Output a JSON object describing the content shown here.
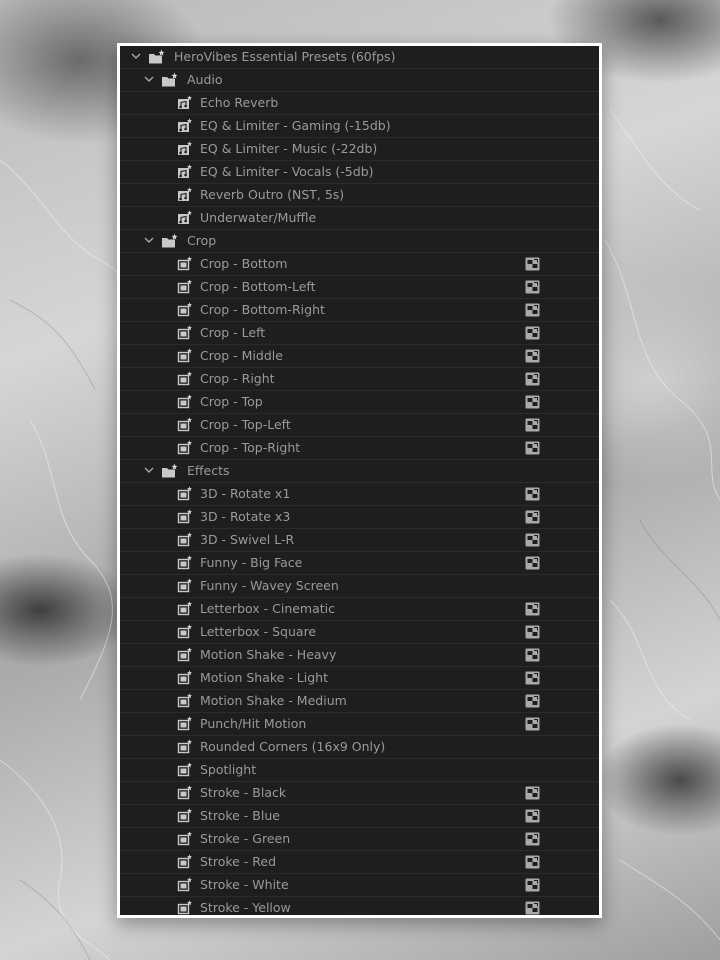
{
  "tree": {
    "root": {
      "label": "HeroVibes Essential Presets (60fps)",
      "icon": "preset-bin-icon",
      "expanded": true,
      "folders": [
        {
          "label": "Audio",
          "icon": "preset-bin-icon",
          "expanded": true,
          "items": [
            {
              "label": "Echo Reverb",
              "type": "audio",
              "accelerated": false
            },
            {
              "label": "EQ & Limiter - Gaming (-15db)",
              "type": "audio",
              "accelerated": false
            },
            {
              "label": "EQ & Limiter - Music (-22db)",
              "type": "audio",
              "accelerated": false
            },
            {
              "label": "EQ & Limiter - Vocals (-5db)",
              "type": "audio",
              "accelerated": false
            },
            {
              "label": "Reverb Outro (NST, 5s)",
              "type": "audio",
              "accelerated": false
            },
            {
              "label": "Underwater/Muffle",
              "type": "audio",
              "accelerated": false
            }
          ]
        },
        {
          "label": "Crop",
          "icon": "preset-bin-icon",
          "expanded": true,
          "items": [
            {
              "label": "Crop - Bottom",
              "type": "video",
              "accelerated": true
            },
            {
              "label": "Crop - Bottom-Left",
              "type": "video",
              "accelerated": true
            },
            {
              "label": "Crop - Bottom-Right",
              "type": "video",
              "accelerated": true
            },
            {
              "label": "Crop - Left",
              "type": "video",
              "accelerated": true
            },
            {
              "label": "Crop - Middle",
              "type": "video",
              "accelerated": true
            },
            {
              "label": "Crop - Right",
              "type": "video",
              "accelerated": true
            },
            {
              "label": "Crop - Top",
              "type": "video",
              "accelerated": true
            },
            {
              "label": "Crop - Top-Left",
              "type": "video",
              "accelerated": true
            },
            {
              "label": "Crop - Top-Right",
              "type": "video",
              "accelerated": true
            }
          ]
        },
        {
          "label": "Effects",
          "icon": "preset-bin-icon",
          "expanded": true,
          "items": [
            {
              "label": "3D - Rotate x1",
              "type": "video",
              "accelerated": true
            },
            {
              "label": "3D - Rotate x3",
              "type": "video",
              "accelerated": true
            },
            {
              "label": "3D - Swivel L-R",
              "type": "video",
              "accelerated": true
            },
            {
              "label": "Funny - Big Face",
              "type": "video",
              "accelerated": true
            },
            {
              "label": "Funny - Wavey Screen",
              "type": "video",
              "accelerated": false
            },
            {
              "label": "Letterbox - Cinematic",
              "type": "video",
              "accelerated": true
            },
            {
              "label": "Letterbox - Square",
              "type": "video",
              "accelerated": true
            },
            {
              "label": "Motion Shake - Heavy",
              "type": "video",
              "accelerated": true
            },
            {
              "label": "Motion Shake - Light",
              "type": "video",
              "accelerated": true
            },
            {
              "label": "Motion Shake - Medium",
              "type": "video",
              "accelerated": true
            },
            {
              "label": "Punch/Hit Motion",
              "type": "video",
              "accelerated": true
            },
            {
              "label": "Rounded Corners (16x9 Only)",
              "type": "video",
              "accelerated": false
            },
            {
              "label": "Spotlight",
              "type": "video",
              "accelerated": false
            },
            {
              "label": "Stroke - Black",
              "type": "video",
              "accelerated": true
            },
            {
              "label": "Stroke - Blue",
              "type": "video",
              "accelerated": true
            },
            {
              "label": "Stroke - Green",
              "type": "video",
              "accelerated": true
            },
            {
              "label": "Stroke - Red",
              "type": "video",
              "accelerated": true
            },
            {
              "label": "Stroke - White",
              "type": "video",
              "accelerated": true
            },
            {
              "label": "Stroke - Yellow",
              "type": "video",
              "accelerated": true
            }
          ]
        }
      ]
    }
  },
  "icons": {
    "audio_preset": "audio-preset-icon",
    "video_preset": "video-preset-icon",
    "accelerated": "accelerated-effect-icon",
    "expanded": "chevron-down-icon"
  },
  "colors": {
    "panel_bg": "#1e1e1e",
    "row_divider": "#2b2b2b",
    "text": "#9a9a9a",
    "icon": "#bdbdbd",
    "frame": "#ffffff"
  }
}
